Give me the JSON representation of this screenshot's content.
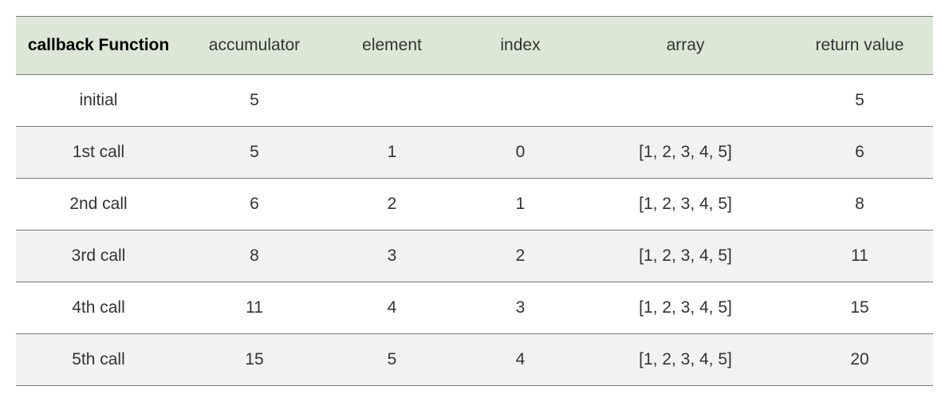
{
  "headers": [
    "callback Function",
    "accumulator",
    "element",
    "index",
    "array",
    "return value"
  ],
  "rows": [
    {
      "call": "initial",
      "accumulator": "5",
      "element": "",
      "index": "",
      "array": "",
      "return": "5"
    },
    {
      "call": "1st call",
      "accumulator": "5",
      "element": "1",
      "index": "0",
      "array": "[1, 2, 3, 4, 5]",
      "return": "6"
    },
    {
      "call": "2nd call",
      "accumulator": "6",
      "element": "2",
      "index": "1",
      "array": "[1, 2, 3, 4, 5]",
      "return": "8"
    },
    {
      "call": "3rd call",
      "accumulator": "8",
      "element": "3",
      "index": "2",
      "array": "[1, 2, 3, 4, 5]",
      "return": "11"
    },
    {
      "call": "4th call",
      "accumulator": "11",
      "element": "4",
      "index": "3",
      "array": "[1, 2, 3, 4, 5]",
      "return": "15"
    },
    {
      "call": "5th call",
      "accumulator": "15",
      "element": "5",
      "index": "4",
      "array": "[1, 2, 3, 4, 5]",
      "return": "20"
    }
  ],
  "chart_data": {
    "type": "table",
    "title": "",
    "columns": [
      "callback Function",
      "accumulator",
      "element",
      "index",
      "array",
      "return value"
    ],
    "data": [
      [
        "initial",
        5,
        null,
        null,
        null,
        5
      ],
      [
        "1st call",
        5,
        1,
        0,
        "[1, 2, 3, 4, 5]",
        6
      ],
      [
        "2nd call",
        6,
        2,
        1,
        "[1, 2, 3, 4, 5]",
        8
      ],
      [
        "3rd call",
        8,
        3,
        2,
        "[1, 2, 3, 4, 5]",
        11
      ],
      [
        "4th call",
        11,
        4,
        3,
        "[1, 2, 3, 4, 5]",
        15
      ],
      [
        "5th call",
        15,
        5,
        4,
        "[1, 2, 3, 4, 5]",
        20
      ]
    ]
  }
}
